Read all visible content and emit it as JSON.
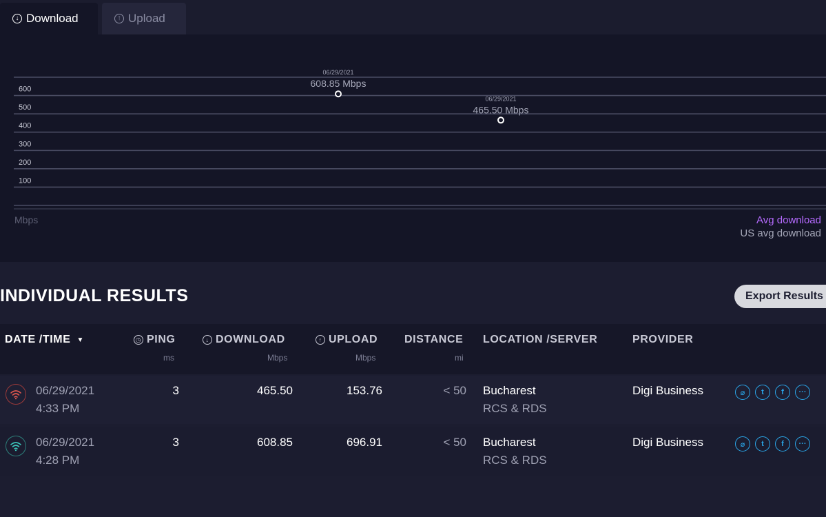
{
  "tabs": {
    "download_label": "Download",
    "upload_label": "Upload"
  },
  "chart_data": {
    "type": "line",
    "x": [
      "06/29/2021 4:28 PM",
      "06/29/2021 4:33 PM"
    ],
    "series": [
      {
        "values": [
          608.85,
          465.5
        ],
        "point_labels": [
          "608.85 Mbps",
          "465.50 Mbps"
        ],
        "point_dates": [
          "06/29/2021",
          "06/29/2021"
        ]
      }
    ],
    "yticks": [
      "100",
      "200",
      "300",
      "400",
      "500",
      "600"
    ],
    "ylabel": "Mbps",
    "ylim": [
      0,
      700
    ],
    "grid": true,
    "legend": [
      "Avg download",
      "US avg download"
    ],
    "legend_position": "bottom-right",
    "colors": {
      "avg": "#b66bff",
      "us_avg": "#a5a7b8"
    }
  },
  "results": {
    "title": "INDIVIDUAL RESULTS",
    "export_label": "Export Results",
    "columns": {
      "datetime": "DATE /TIME",
      "ping": "PING",
      "ping_unit": "ms",
      "download": "DOWNLOAD",
      "download_unit": "Mbps",
      "upload": "UPLOAD",
      "upload_unit": "Mbps",
      "distance": "DISTANCE",
      "distance_unit": "mi",
      "location": "LOCATION /SERVER",
      "provider": "PROVIDER"
    },
    "rows": [
      {
        "date": "06/29/2021",
        "time": "4:33 PM",
        "ping": "3",
        "download": "465.50",
        "upload": "153.76",
        "distance": "< 50",
        "location": "Bucharest",
        "server": "RCS & RDS",
        "provider": "Digi Business",
        "status_color": "#e0584f"
      },
      {
        "date": "06/29/2021",
        "time": "4:28 PM",
        "ping": "3",
        "download": "608.85",
        "upload": "696.91",
        "distance": "< 50",
        "location": "Bucharest",
        "server": "RCS & RDS",
        "provider": "Digi Business",
        "status_color": "#3cc6bb"
      }
    ]
  }
}
